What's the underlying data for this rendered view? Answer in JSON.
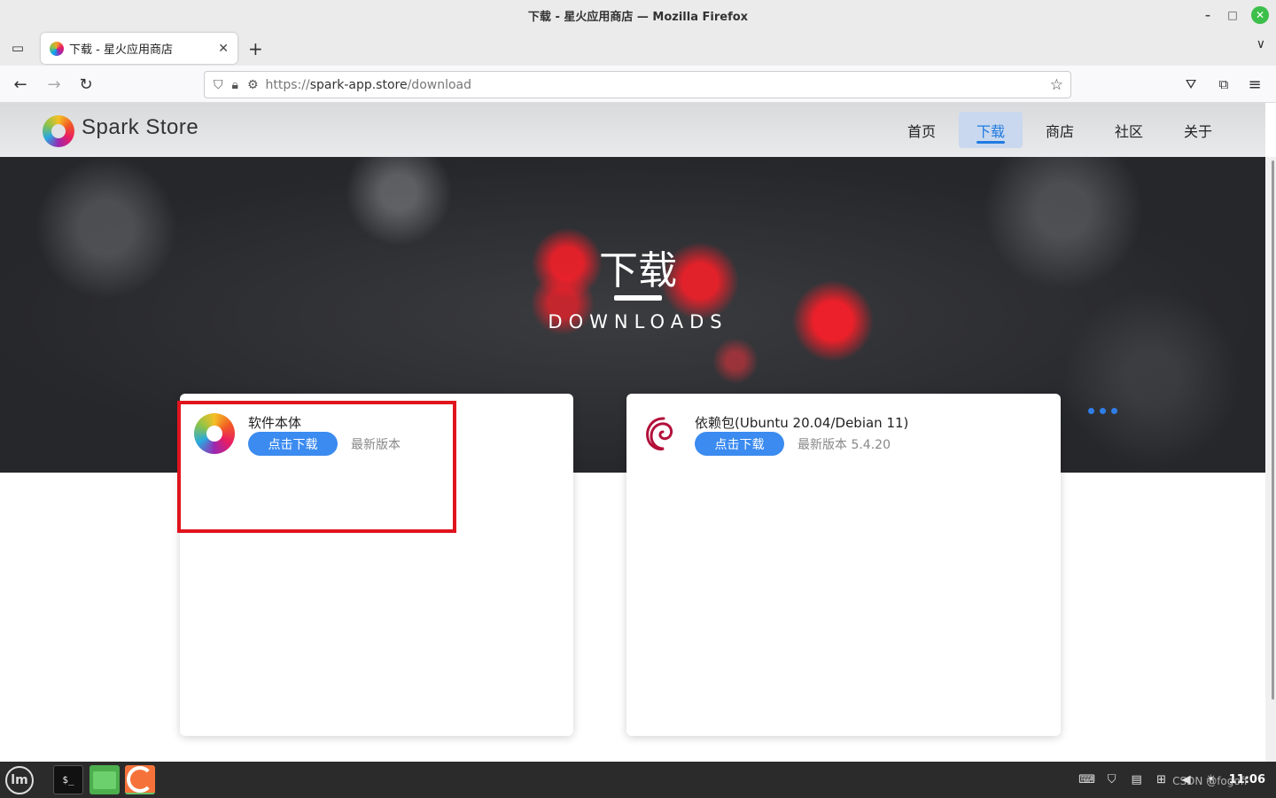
{
  "window": {
    "title": "下载 - 星火应用商店 — Mozilla Firefox"
  },
  "browser": {
    "tab_title": "下载 - 星火应用商店",
    "url_scheme": "https://",
    "url_host": "spark-app.store",
    "url_path": "/download"
  },
  "site": {
    "brand": "Spark Store",
    "nav": [
      {
        "label": "首页",
        "active": false
      },
      {
        "label": "下载",
        "active": true
      },
      {
        "label": "商店",
        "active": false
      },
      {
        "label": "社区",
        "active": false
      },
      {
        "label": "关于",
        "active": false
      }
    ]
  },
  "hero": {
    "title": "下载",
    "subtitle": "DOWNLOADS"
  },
  "cards": [
    {
      "title": "软件本体",
      "button": "点击下载",
      "version": "最新版本"
    },
    {
      "title": "依赖包(Ubuntu 20.04/Debian 11)",
      "button": "点击下载",
      "version": "最新版本 5.4.20"
    }
  ],
  "taskbar": {
    "clock": "11:06",
    "watermark": "CSDN @fogoff"
  },
  "colors": {
    "accent": "#3b8bf0",
    "highlight_box": "#e0141e"
  }
}
